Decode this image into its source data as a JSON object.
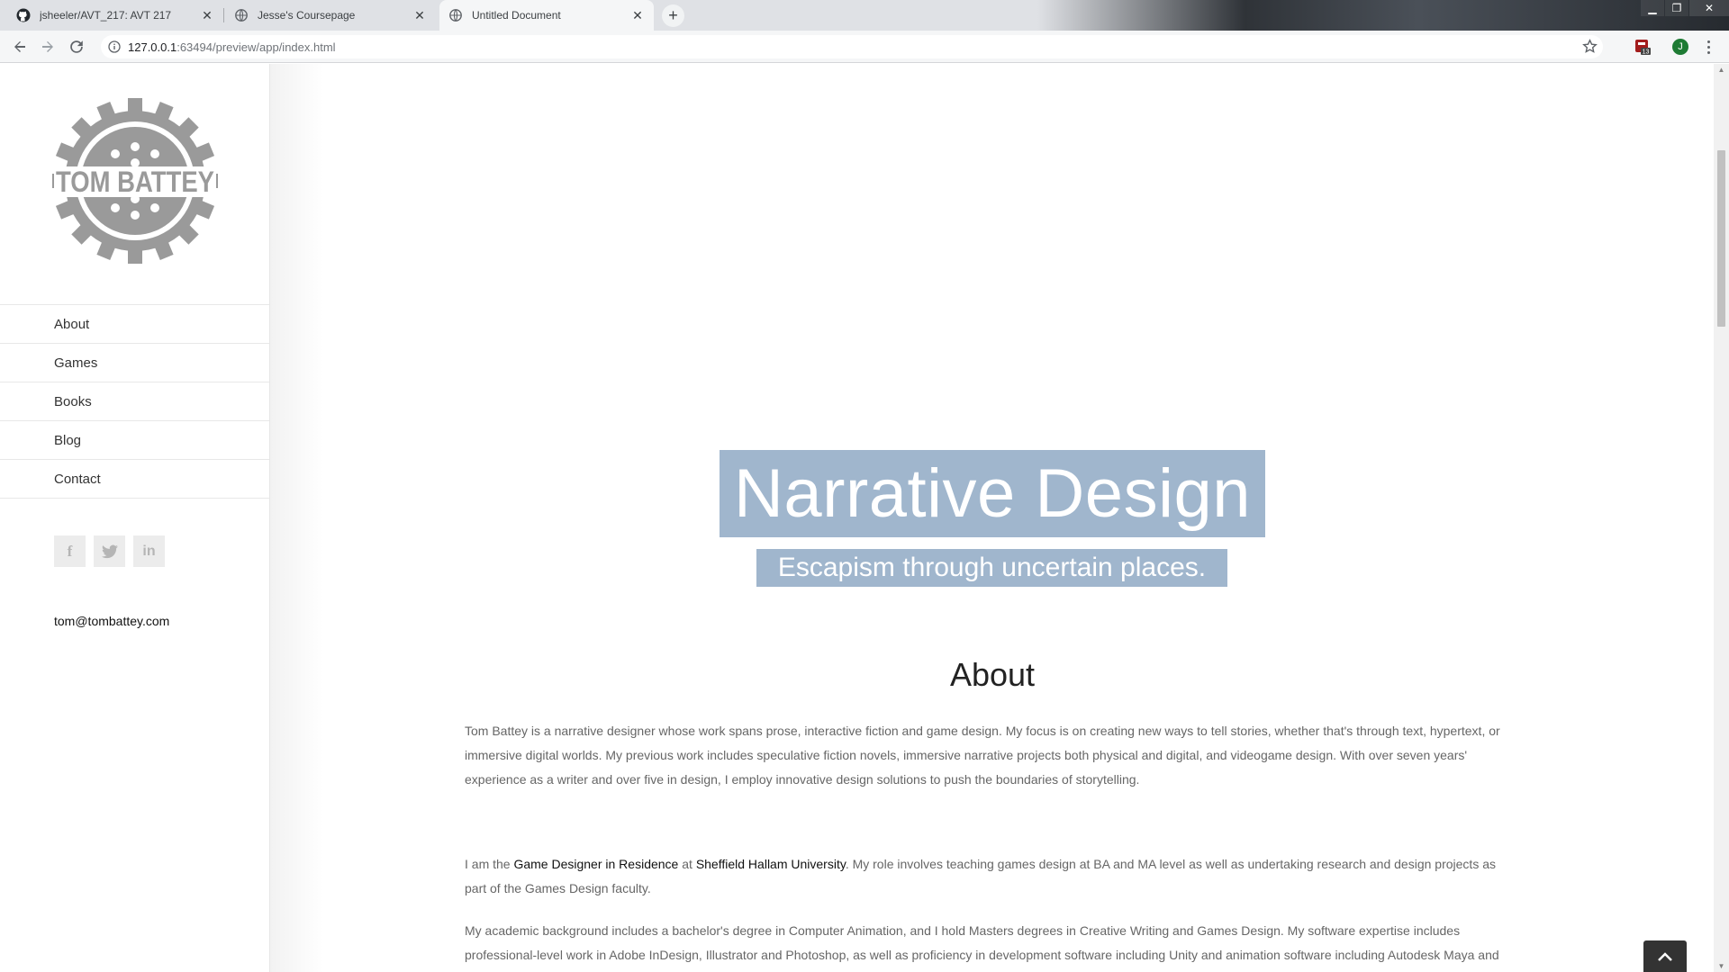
{
  "browser": {
    "tabs": [
      {
        "title": "jsheeler/AVT_217: AVT 217",
        "icon": "github-icon",
        "active": false
      },
      {
        "title": "Jesse's Coursepage",
        "icon": "globe-icon",
        "active": false
      },
      {
        "title": "Untitled Document",
        "icon": "globe-icon",
        "active": true
      }
    ],
    "new_tab_label": "+",
    "url_host": "127.0.0.1",
    "url_rest": ":63494/preview/app/index.html",
    "extension_badge": "13",
    "profile_initial": "J"
  },
  "sidebar": {
    "logo_text": "TOM BATTEY",
    "nav": [
      "About",
      "Games",
      "Books",
      "Blog",
      "Contact"
    ],
    "social": [
      {
        "name": "facebook-icon",
        "glyph": "f"
      },
      {
        "name": "twitter-icon",
        "glyph": "🐦"
      },
      {
        "name": "linkedin-icon",
        "glyph": "in"
      }
    ],
    "email": "tom@tombattey.com"
  },
  "hero": {
    "title": "Narrative Design",
    "subtitle": "Escapism through uncertain places.",
    "accent_color": "#a0b6cd"
  },
  "about": {
    "heading": "About",
    "p1": "Tom Battey is a narrative designer whose work spans prose, interactive fiction and game design. My focus is on creating new ways to tell stories, whether that's through text, hypertext, or immersive digital worlds. My previous work includes speculative fiction novels, immersive narrative projects both physical and digital, and videogame design. With over seven years' experience as a writer and over five in design, I employ innovative design solutions to push the boundaries of storytelling.",
    "p2_a": "I am the ",
    "p2_link1": "Game Designer in Residence",
    "p2_b": " at ",
    "p2_link2": "Sheffield Hallam University",
    "p2_c": ". My role involves teaching games design at BA and MA level as well as undertaking research and design projects as part of the Games Design faculty.",
    "p3": "My academic background includes a bachelor's degree in Computer Animation, and I hold Masters degrees in Creative Writing and Games Design. My software expertise includes professional-level work in Adobe InDesign, Illustrator and Photoshop, as well as proficiency in development software including Unity and animation software including Autodesk Maya and Adobe Flash."
  }
}
